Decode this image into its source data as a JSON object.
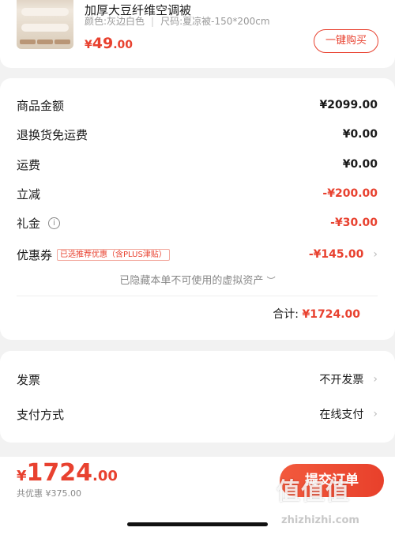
{
  "product": {
    "title": "加厚大豆纤维空调被",
    "spec_color": "颜色:灰边白色",
    "spec_size": "尺码:夏凉被-150*200cm",
    "price_symbol": "¥",
    "price_int": "49",
    "price_dec": ".00",
    "buy_label": "一键购买"
  },
  "amounts": {
    "rows": [
      {
        "label": "商品金额",
        "value": "¥2099.00"
      },
      {
        "label": "退换货免运费",
        "value": "¥0.00"
      },
      {
        "label": "运费",
        "value": "¥0.00"
      },
      {
        "label": "立减",
        "value": "-¥200.00"
      },
      {
        "label": "礼金",
        "value": "-¥30.00"
      },
      {
        "label": "优惠券",
        "value": "-¥145.00",
        "tag": "已选推荐优惠（含PLUS津贴）"
      }
    ],
    "hidden_note": "已隐藏本单不可使用的虚拟资产",
    "total_label": "合计:",
    "total_value": "¥1724.00"
  },
  "options": {
    "invoice_label": "发票",
    "invoice_value": "不开发票",
    "payment_label": "支付方式",
    "payment_value": "在线支付"
  },
  "footer": {
    "price_symbol": "¥",
    "price_int": "1724",
    "price_dec": ".00",
    "saving": "共优惠 ¥375.00",
    "submit_label": "提交订单"
  },
  "watermark": {
    "mark": "值值值",
    "url": "zhizhizhi.com"
  },
  "colors": {
    "accent": "#e8412f",
    "background": "#f2f2f2"
  }
}
